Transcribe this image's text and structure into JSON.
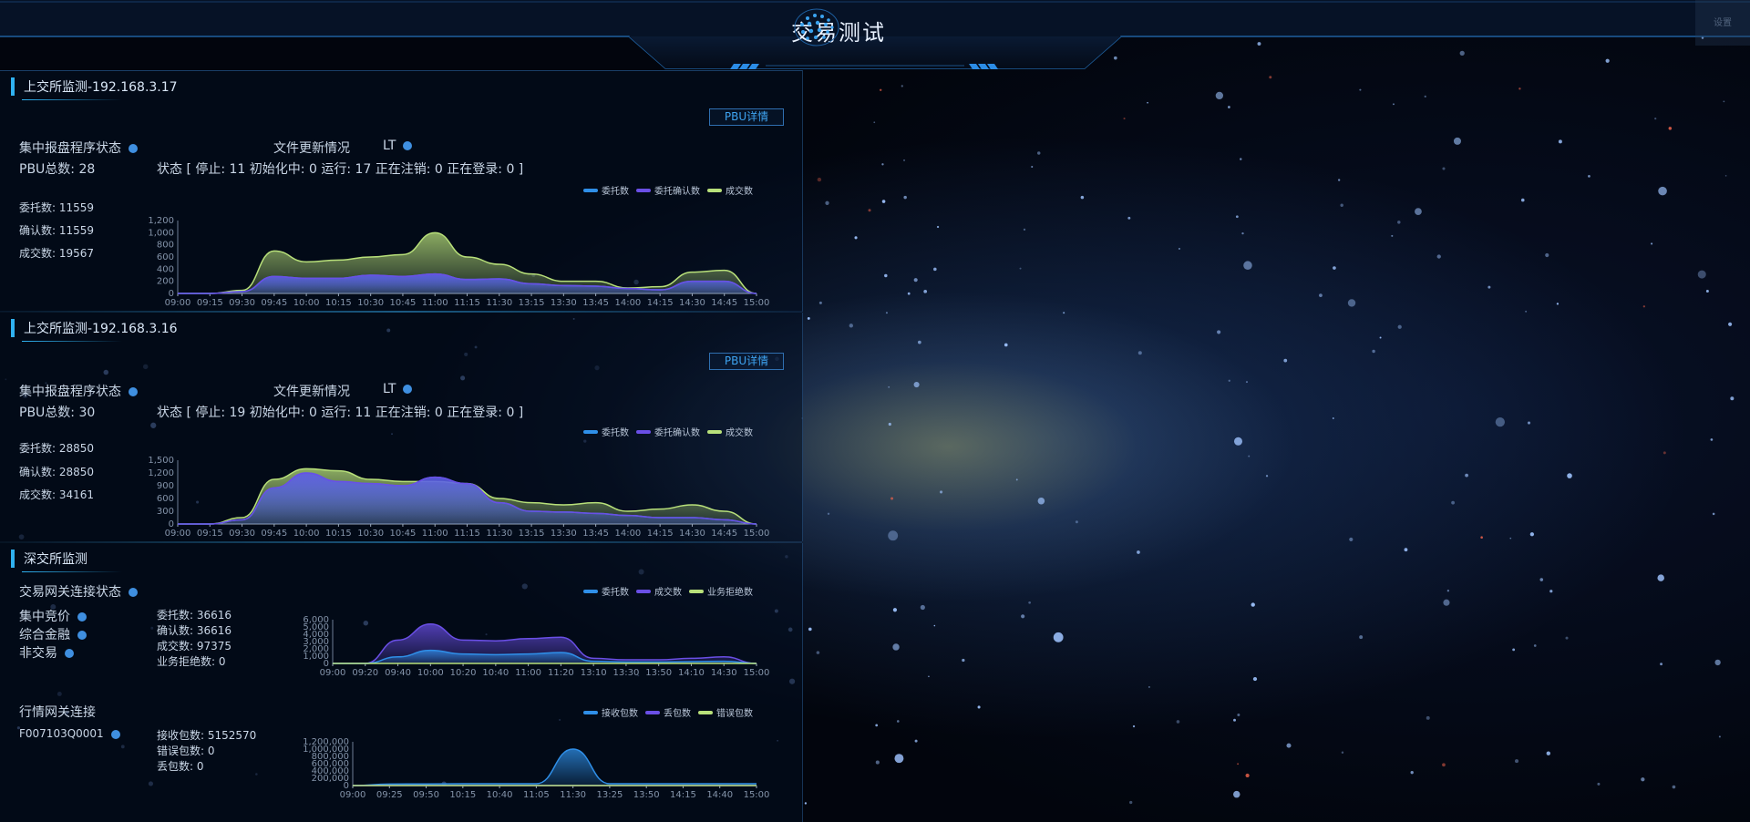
{
  "header": {
    "title": "交易测试",
    "settings_label": "设置"
  },
  "sh1": {
    "title": "上交所监测-192.168.3.17",
    "pbu_button": "PBU详情",
    "process_label": "集中报盘程序状态",
    "file_label": "文件更新情况",
    "lt_label": "LT",
    "pbu_total": "PBU总数:  28",
    "status_text": "状态 [ 停止: 11   初始化中: 0   运行: 17   正在注销: 0   正在登录: 0 ]",
    "stats": [
      "委托数: 11559",
      "确认数: 11559",
      "成交数: 19567"
    ]
  },
  "sh2": {
    "title": "上交所监测-192.168.3.16",
    "pbu_button": "PBU详情",
    "process_label": "集中报盘程序状态",
    "file_label": "文件更新情况",
    "lt_label": "LT",
    "pbu_total": "PBU总数:  30",
    "status_text": "状态 [ 停止: 19   初始化中: 0   运行: 11   正在注销: 0   正在登录: 0 ]",
    "stats": [
      "委托数: 28850",
      "确认数: 28850",
      "成交数: 34161"
    ]
  },
  "sz": {
    "title": "深交所监测",
    "gateway_label": "交易网关连接状态",
    "items": [
      "集中竞价",
      "综合金融",
      "非交易"
    ],
    "stats": [
      "委托数: 36616",
      "确认数: 36616",
      "成交数: 97375",
      "业务拒绝数: 0"
    ],
    "market_label": "行情网关连接",
    "market_id": "F007103Q0001",
    "market_stats": [
      "接收包数: 5152570",
      "错误包数: 0",
      "丢包数: 0"
    ]
  },
  "chart_data": [
    {
      "type": "area",
      "x": [
        "09:00",
        "09:15",
        "09:30",
        "09:45",
        "10:00",
        "10:15",
        "10:30",
        "10:45",
        "11:00",
        "11:15",
        "11:30",
        "13:15",
        "13:30",
        "13:45",
        "14:00",
        "14:15",
        "14:30",
        "14:45",
        "15:00"
      ],
      "ylim": [
        0,
        1200
      ],
      "yticks": [
        "0",
        "200",
        "400",
        "600",
        "800",
        "1,000",
        "1,200"
      ],
      "legend": [
        "委托数",
        "委托确认数",
        "成交数"
      ],
      "series": [
        {
          "name": "委托数",
          "color": "#2f8fe8",
          "values": [
            0,
            0,
            30,
            280,
            250,
            250,
            300,
            280,
            320,
            230,
            240,
            160,
            130,
            120,
            80,
            60,
            200,
            200,
            0
          ]
        },
        {
          "name": "委托确认数",
          "color": "#6a4fe6",
          "values": [
            0,
            0,
            30,
            280,
            250,
            250,
            300,
            280,
            320,
            230,
            240,
            160,
            130,
            120,
            80,
            60,
            200,
            200,
            0
          ]
        },
        {
          "name": "成交数",
          "color": "#b8e07a",
          "values": [
            0,
            0,
            50,
            700,
            520,
            550,
            600,
            640,
            1000,
            600,
            480,
            320,
            200,
            200,
            90,
            110,
            350,
            380,
            0
          ]
        }
      ]
    },
    {
      "type": "area",
      "x": [
        "09:00",
        "09:15",
        "09:30",
        "09:45",
        "10:00",
        "10:15",
        "10:30",
        "10:45",
        "11:00",
        "11:15",
        "11:30",
        "13:15",
        "13:30",
        "13:45",
        "14:00",
        "14:15",
        "14:30",
        "14:45",
        "15:00"
      ],
      "ylim": [
        0,
        1500
      ],
      "yticks": [
        "0",
        "300",
        "600",
        "900",
        "1,200",
        "1,500"
      ],
      "legend": [
        "委托数",
        "委托确认数",
        "成交数"
      ],
      "series": [
        {
          "name": "委托数",
          "color": "#2f8fe8",
          "values": [
            0,
            0,
            100,
            850,
            1200,
            1000,
            950,
            900,
            1100,
            950,
            500,
            300,
            280,
            250,
            200,
            150,
            150,
            100,
            0
          ]
        },
        {
          "name": "委托确认数",
          "color": "#6a4fe6",
          "values": [
            0,
            0,
            100,
            850,
            1200,
            1000,
            950,
            900,
            1100,
            950,
            500,
            300,
            280,
            250,
            200,
            150,
            150,
            100,
            0
          ]
        },
        {
          "name": "成交数",
          "color": "#b8e07a",
          "values": [
            0,
            0,
            150,
            1050,
            1300,
            1250,
            1050,
            1000,
            1000,
            950,
            600,
            500,
            450,
            500,
            300,
            350,
            450,
            300,
            0
          ]
        }
      ]
    },
    {
      "type": "area",
      "x": [
        "09:00",
        "09:20",
        "09:40",
        "10:00",
        "10:20",
        "10:40",
        "11:00",
        "11:20",
        "13:10",
        "13:30",
        "13:50",
        "14:10",
        "14:30",
        "15:00"
      ],
      "ylim": [
        0,
        6000
      ],
      "yticks": [
        "0",
        "1,000",
        "2,000",
        "3,000",
        "4,000",
        "5,000",
        "6,000"
      ],
      "legend": [
        "委托数",
        "成交数",
        "业务拒绝数"
      ],
      "series": [
        {
          "name": "委托数",
          "color": "#2f8fe8",
          "values": [
            0,
            0,
            900,
            1800,
            1300,
            1200,
            1300,
            1500,
            300,
            200,
            200,
            250,
            300,
            0
          ]
        },
        {
          "name": "成交数",
          "color": "#6a4fe6",
          "values": [
            0,
            0,
            3200,
            5400,
            3200,
            3100,
            3400,
            3600,
            700,
            500,
            500,
            700,
            900,
            0
          ]
        },
        {
          "name": "业务拒绝数",
          "color": "#b8e07a",
          "values": [
            0,
            0,
            0,
            0,
            0,
            0,
            0,
            0,
            0,
            0,
            0,
            0,
            0,
            0
          ]
        }
      ]
    },
    {
      "type": "area",
      "x": [
        "09:00",
        "09:25",
        "09:50",
        "10:15",
        "10:40",
        "11:05",
        "11:30",
        "13:25",
        "13:50",
        "14:15",
        "14:40",
        "15:00"
      ],
      "ylim": [
        0,
        1200000
      ],
      "yticks": [
        "0",
        "200,000",
        "400,000",
        "600,000",
        "800,000",
        "1,000,000",
        "1,200,000"
      ],
      "legend": [
        "接收包数",
        "丢包数",
        "错误包数"
      ],
      "series": [
        {
          "name": "接收包数",
          "color": "#2f8fe8",
          "values": [
            0,
            40000,
            45000,
            50000,
            50000,
            50000,
            1000000,
            50000,
            50000,
            50000,
            50000,
            50000
          ]
        },
        {
          "name": "丢包数",
          "color": "#6a4fe6",
          "values": [
            0,
            0,
            0,
            0,
            0,
            0,
            0,
            0,
            0,
            0,
            0,
            0
          ]
        },
        {
          "name": "错误包数",
          "color": "#b8e07a",
          "values": [
            0,
            0,
            0,
            0,
            0,
            0,
            0,
            0,
            0,
            0,
            0,
            0
          ]
        }
      ]
    }
  ]
}
